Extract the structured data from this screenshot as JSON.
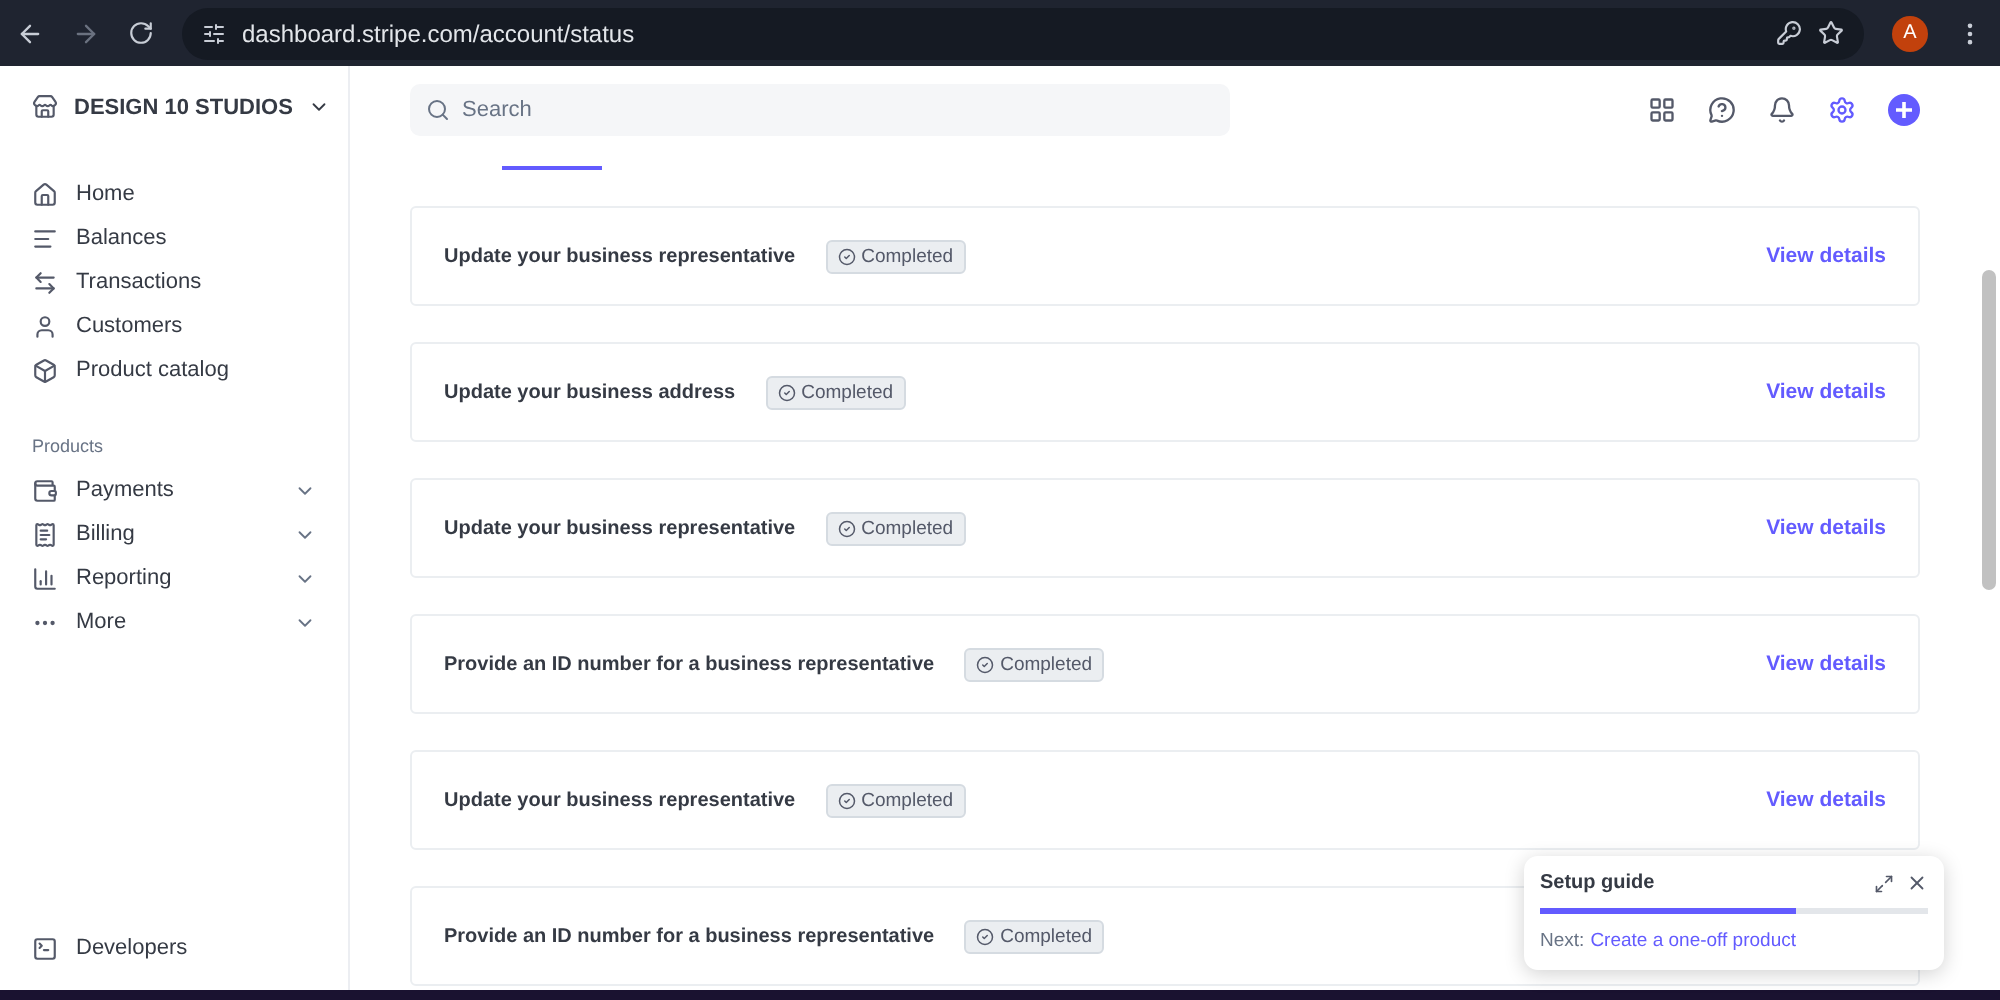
{
  "browser": {
    "url": "dashboard.stripe.com/account/status",
    "avatar": "A"
  },
  "sidebar": {
    "account": "DESIGN 10 STUDIOS",
    "items": [
      {
        "label": "Home"
      },
      {
        "label": "Balances"
      },
      {
        "label": "Transactions"
      },
      {
        "label": "Customers"
      },
      {
        "label": "Product catalog"
      }
    ],
    "section": "Products",
    "products": [
      {
        "label": "Payments",
        "expanded": false
      },
      {
        "label": "Billing",
        "expanded": false
      },
      {
        "label": "Reporting",
        "expanded": false
      },
      {
        "label": "More",
        "expanded": false
      }
    ],
    "footer": {
      "label": "Developers"
    }
  },
  "search": {
    "placeholder": "Search"
  },
  "tasks": [
    {
      "title": "Update your business representative",
      "status": "Completed",
      "link": "View details"
    },
    {
      "title": "Update your business address",
      "status": "Completed",
      "link": "View details"
    },
    {
      "title": "Update your business representative",
      "status": "Completed",
      "link": "View details"
    },
    {
      "title": "Provide an ID number for a business representative",
      "status": "Completed",
      "link": "View details"
    },
    {
      "title": "Update your business representative",
      "status": "Completed",
      "link": "View details"
    },
    {
      "title": "Provide an ID number for a business representative",
      "status": "Completed"
    }
  ],
  "setup_guide": {
    "title": "Setup guide",
    "level": 0.66,
    "next_label": "Next:",
    "next_link": "Create a one-off product"
  }
}
